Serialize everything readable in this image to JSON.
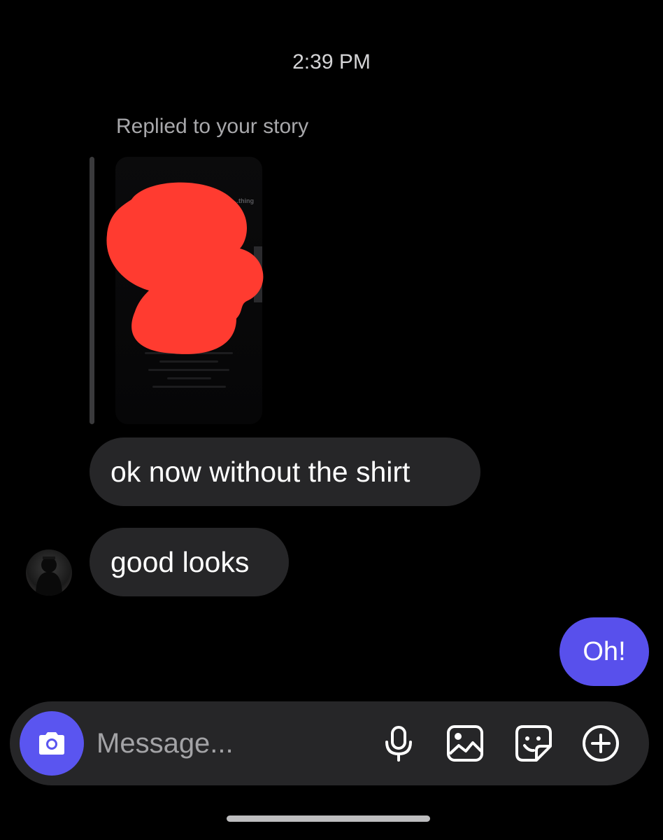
{
  "conversation": {
    "timestamp": "2:39 PM",
    "reply_label": "Replied to your story",
    "story_thumbnail": {
      "caption_fragment": "...thing"
    },
    "incoming_messages": [
      {
        "text": "ok now without the shirt"
      },
      {
        "text": "good looks"
      }
    ],
    "outgoing_messages": [
      {
        "text": "Oh!"
      }
    ]
  },
  "composer": {
    "placeholder": "Message...",
    "icons": [
      "camera-icon",
      "microphone-icon",
      "gallery-icon",
      "sticker-icon",
      "plus-icon"
    ]
  },
  "colors": {
    "background": "#000000",
    "incoming_bubble": "#262628",
    "outgoing_bubble": "#5850ec",
    "camera_button": "#5a55f0",
    "redaction": "#ff3b30"
  }
}
